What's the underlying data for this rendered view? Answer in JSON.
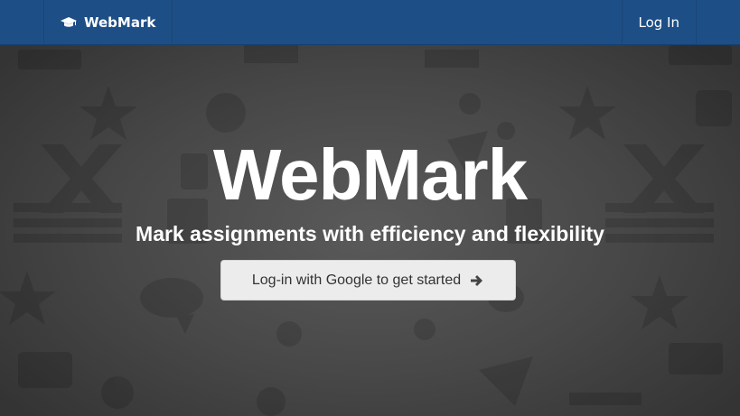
{
  "navbar": {
    "brand_label": "WebMark",
    "brand_icon": "graduation-cap-icon",
    "login_label": "Log In"
  },
  "hero": {
    "title": "WebMark",
    "subtitle": "Mark assignments with efficiency and flexibility",
    "cta_label": "Log-in with Google to get started",
    "cta_icon": "arrow-right-icon"
  },
  "colors": {
    "navbar_bg": "#1d4f86",
    "hero_bg": "#474747",
    "button_bg": "#ececec",
    "text_light": "#ffffff",
    "text_dark": "#333333"
  }
}
